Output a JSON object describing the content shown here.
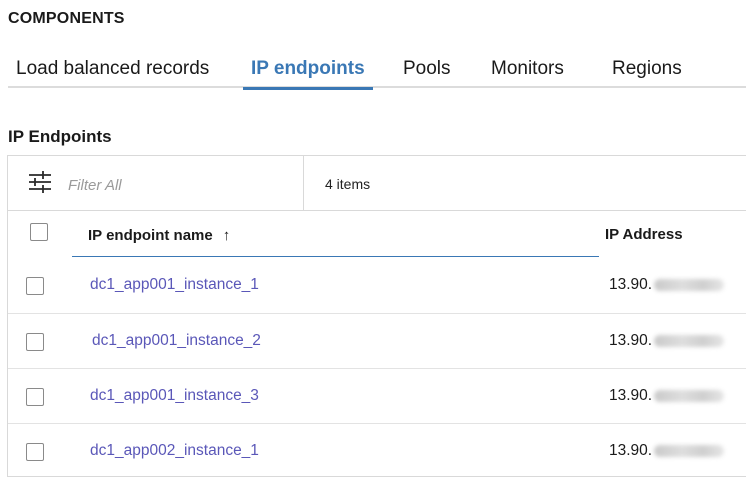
{
  "section_title": "COMPONENTS",
  "tabs": [
    {
      "label": "Load balanced records",
      "active": false
    },
    {
      "label": "IP endpoints",
      "active": true
    },
    {
      "label": "Pools",
      "active": false
    },
    {
      "label": "Monitors",
      "active": false
    },
    {
      "label": "Regions",
      "active": false
    }
  ],
  "subheading": "IP Endpoints",
  "toolbar": {
    "filter_placeholder": "Filter All",
    "filter_icon": "filter-sliders-icon",
    "item_count": "4 items"
  },
  "table": {
    "columns": {
      "name": "IP endpoint name",
      "sort_indicator": "↑",
      "ip": "IP Address"
    },
    "rows": [
      {
        "name": "dc1_app001_instance_1",
        "ip_prefix": "13.90."
      },
      {
        "name": "dc1_app001_instance_2",
        "ip_prefix": "13.90."
      },
      {
        "name": "dc1_app001_instance_3",
        "ip_prefix": "13.90."
      },
      {
        "name": "dc1_app002_instance_1",
        "ip_prefix": "13.90."
      }
    ]
  },
  "colors": {
    "accent": "#3a78b5",
    "link": "#5a57b8"
  }
}
